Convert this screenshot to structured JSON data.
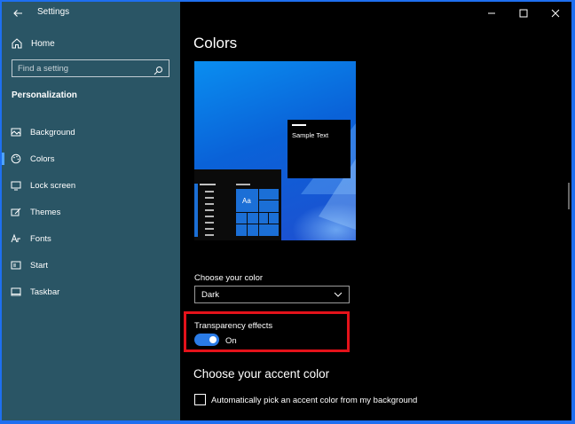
{
  "window": {
    "title": "Settings"
  },
  "sidebar": {
    "home_label": "Home",
    "search_placeholder": "Find a setting",
    "section_label": "Personalization",
    "items": [
      {
        "label": "Background",
        "icon": "picture-icon"
      },
      {
        "label": "Colors",
        "icon": "palette-icon",
        "active": true
      },
      {
        "label": "Lock screen",
        "icon": "lock-screen-icon"
      },
      {
        "label": "Themes",
        "icon": "themes-icon"
      },
      {
        "label": "Fonts",
        "icon": "fonts-icon"
      },
      {
        "label": "Start",
        "icon": "start-icon"
      },
      {
        "label": "Taskbar",
        "icon": "taskbar-icon"
      }
    ]
  },
  "main": {
    "title": "Colors",
    "preview": {
      "sample_text": "Sample Text",
      "tile_text": "Aa"
    },
    "choose_color": {
      "label": "Choose your color",
      "value": "Dark"
    },
    "transparency": {
      "label": "Transparency effects",
      "state": "On"
    },
    "accent": {
      "heading": "Choose your accent color",
      "auto_pick_label": "Automatically pick an accent color from my background",
      "auto_pick_checked": false
    }
  },
  "colors": {
    "sidebar_bg": "#2a5565",
    "content_bg": "#000000",
    "accent": "#2a7be6",
    "highlight_border": "#e4121a"
  }
}
